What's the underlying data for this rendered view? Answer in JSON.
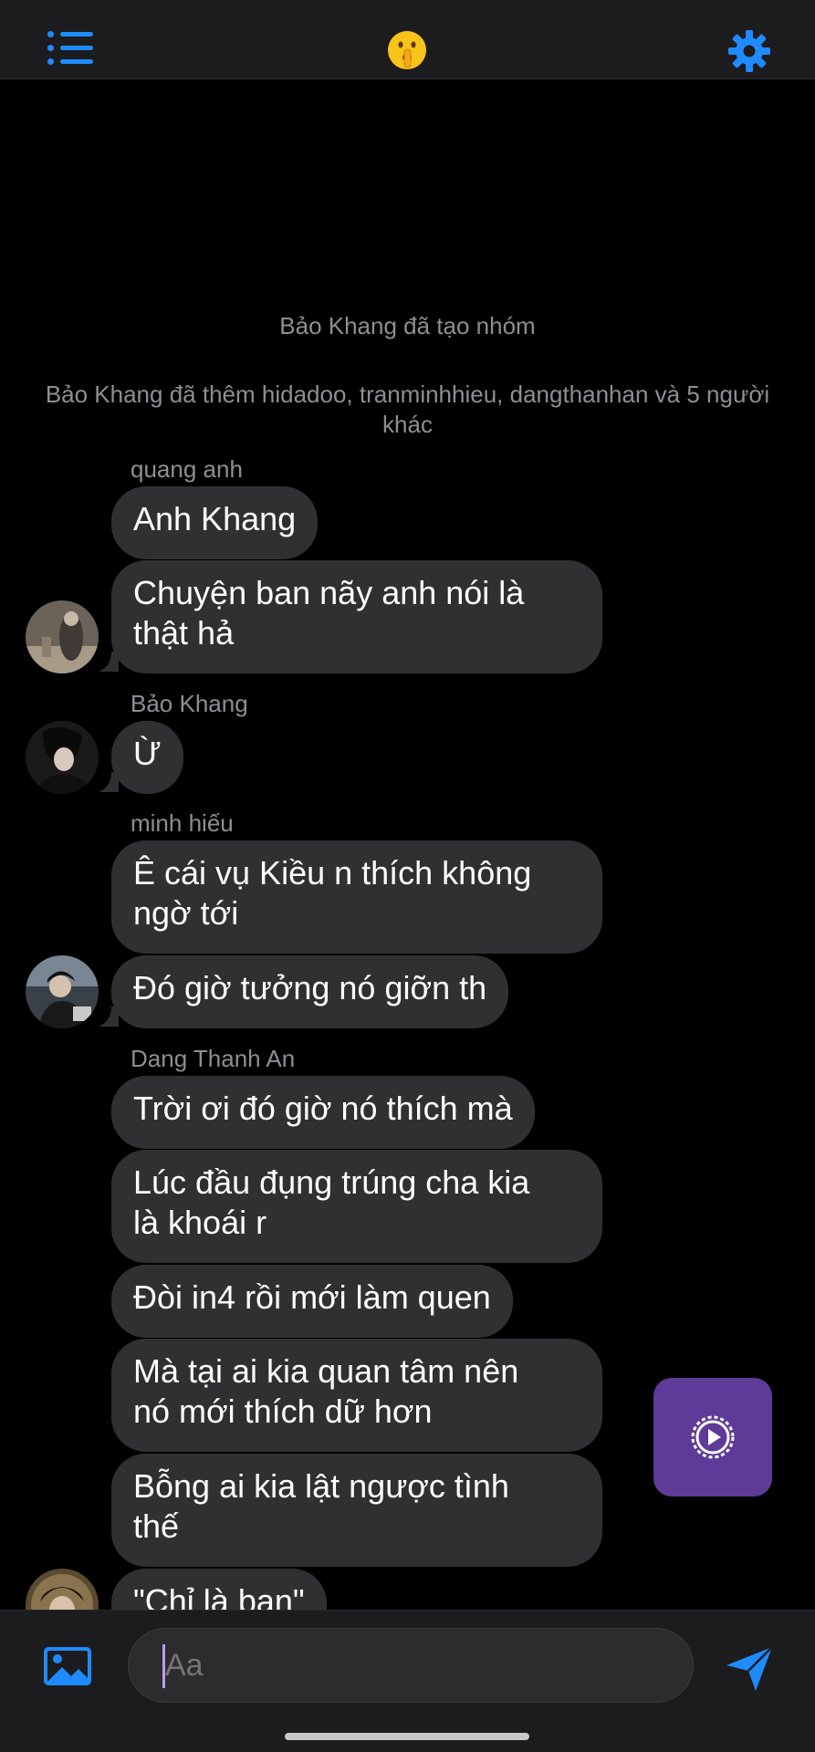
{
  "header": {
    "menu_icon": "list-menu-icon",
    "title_emoji": "🤫",
    "settings_icon": "gear-icon",
    "accent_color": "#1f8bff"
  },
  "messages": {
    "system": [
      "Bảo Khang đã tạo nhóm",
      "Bảo Khang đã thêm hidadoo, tranminhhieu, dangthanhan và 5 người khác"
    ],
    "groups": [
      {
        "sender": "quang anh",
        "bubbles": [
          "Anh Khang",
          "Chuyện ban nãy anh nói là\nthật hả"
        ]
      },
      {
        "sender": "Bảo Khang",
        "bubbles": [
          "Ừ"
        ]
      },
      {
        "sender": "minh hiếu",
        "bubbles": [
          "Ê cái vụ Kiều n thích không\nngờ tới",
          "Đó giờ tưởng nó giỡn th"
        ]
      },
      {
        "sender": "Dang Thanh An",
        "bubbles": [
          "Trời ơi đó giờ nó thích mà",
          "Lúc đầu đụng trúng cha kia\nlà khoái r",
          "Đòi in4 rồi mới làm quen",
          "Mà tại ai kia quan tâm nên\nnó mới thích dữ hơn",
          "Bỗng ai kia lật ngược tình\nthế",
          "\"Chỉ là bạn\""
        ]
      }
    ],
    "bubble_color": "#303032"
  },
  "fab": {
    "icon": "play-circle-icon",
    "color": "#5e3b98"
  },
  "composer": {
    "image_icon": "image-icon",
    "placeholder": "Aa",
    "send_icon": "send-icon"
  }
}
